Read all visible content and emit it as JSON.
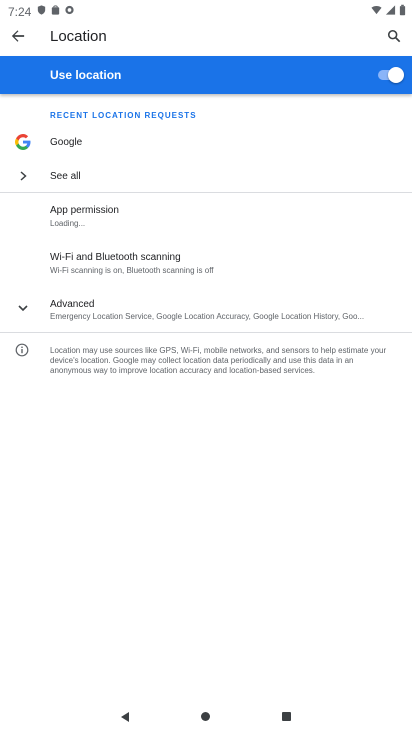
{
  "status_bar": {
    "time": "7:24"
  },
  "toolbar": {
    "title": "Location"
  },
  "master_switch": {
    "label": "Use location",
    "enabled": true
  },
  "recent_requests": {
    "header": "RECENT LOCATION REQUESTS",
    "apps": [
      {
        "name": "Google",
        "icon": "google-icon"
      }
    ],
    "see_all_label": "See all"
  },
  "items": {
    "app_permission": {
      "title": "App permission",
      "subtitle": "Loading..."
    },
    "wifi_bt_scanning": {
      "title": "Wi-Fi and Bluetooth scanning",
      "subtitle": "Wi-Fi scanning is on, Bluetooth scanning is off"
    },
    "advanced": {
      "title": "Advanced",
      "subtitle": "Emergency Location Service, Google Location Accuracy, Google Location History, Goo..."
    }
  },
  "footer": {
    "text": "Location may use sources like GPS, Wi-Fi, mobile networks, and sensors to help estimate your device's location. Google may collect location data periodically and use this data in an anonymous way to improve location accuracy and location-based services."
  },
  "colors": {
    "accent": "#1a73e8",
    "text_primary": "#202124",
    "text_secondary": "#5f6368"
  }
}
